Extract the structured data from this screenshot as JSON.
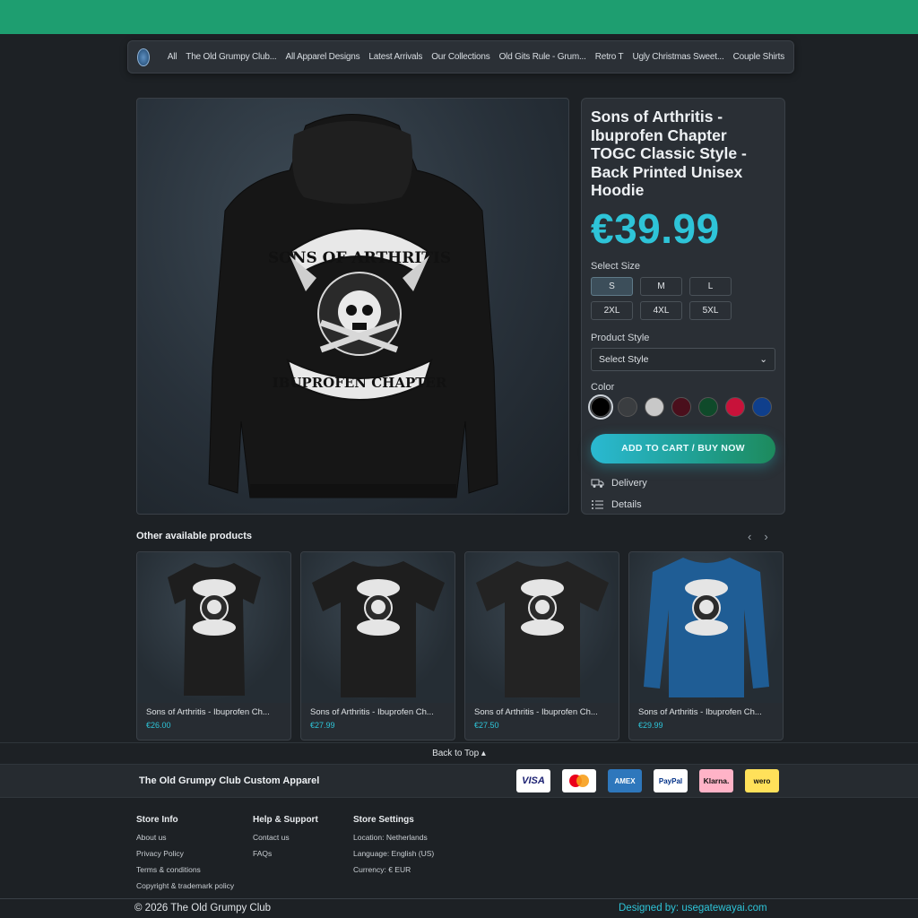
{
  "nav": {
    "items": [
      "All",
      "The Old Grumpy Club...",
      "All Apparel Designs",
      "Latest Arrivals",
      "Our Collections",
      "Old Gits Rule - Grum...",
      "Retro T",
      "Ugly Christmas Sweet...",
      "Couple Shirts"
    ]
  },
  "product": {
    "title": "Sons of Arthritis - Ibuprofen Chapter TOGC Classic Style - Back Printed Unisex Hoodie",
    "price": "€39.99",
    "print_top": "SONS OF ARTHRITIS",
    "print_bottom": "IBUPROFEN CHAPTER",
    "size_label": "Select Size",
    "sizes": [
      "S",
      "M",
      "L",
      "2XL",
      "4XL",
      "5XL"
    ],
    "selected_size": "S",
    "style_label": "Product Style",
    "style_placeholder": "Select Style",
    "color_label": "Color",
    "colors": [
      "#000000",
      "#3a3d40",
      "#c8c8c8",
      "#4a0f1c",
      "#0f4a2a",
      "#c8123a",
      "#0f3f8c"
    ],
    "cta": "ADD TO CART / BUY NOW",
    "delivery": "Delivery",
    "details": "Details",
    "accent": "#2ec4d8"
  },
  "other": {
    "heading": "Other available products",
    "cards": [
      {
        "title": "Sons of Arthritis - Ibuprofen Ch...",
        "price": "€26.00",
        "shirt": "#1e1e1e",
        "kind": "fitted"
      },
      {
        "title": "Sons of Arthritis - Ibuprofen Ch...",
        "price": "€27.99",
        "shirt": "#1e1e1e",
        "kind": "tee"
      },
      {
        "title": "Sons of Arthritis - Ibuprofen Ch...",
        "price": "€27.50",
        "shirt": "#232323",
        "kind": "tee"
      },
      {
        "title": "Sons of Arthritis - Ibuprofen Ch...",
        "price": "€29.99",
        "shirt": "#1f5d95",
        "kind": "longsleeve"
      }
    ]
  },
  "footer": {
    "back_to_top": "Back to Top  ▴",
    "store_name": "The Old Grumpy Club Custom Apparel",
    "payments": [
      "VISA",
      "mastercard",
      "AMEX",
      "PayPal",
      "Klarna.",
      "wero"
    ],
    "store_info": {
      "heading": "Store Info",
      "links": [
        "About us",
        "Privacy Policy",
        "Terms & conditions",
        "Copyright & trademark policy"
      ]
    },
    "help": {
      "heading": "Help & Support",
      "links": [
        "Contact us",
        "FAQs"
      ]
    },
    "settings": {
      "heading": "Store Settings",
      "links": [
        "Location: Netherlands",
        "Language: English (US)",
        "Currency: € EUR"
      ]
    },
    "copyright": "© 2026 The Old Grumpy Club",
    "designed_by": "Designed by: usegatewayai.com"
  }
}
